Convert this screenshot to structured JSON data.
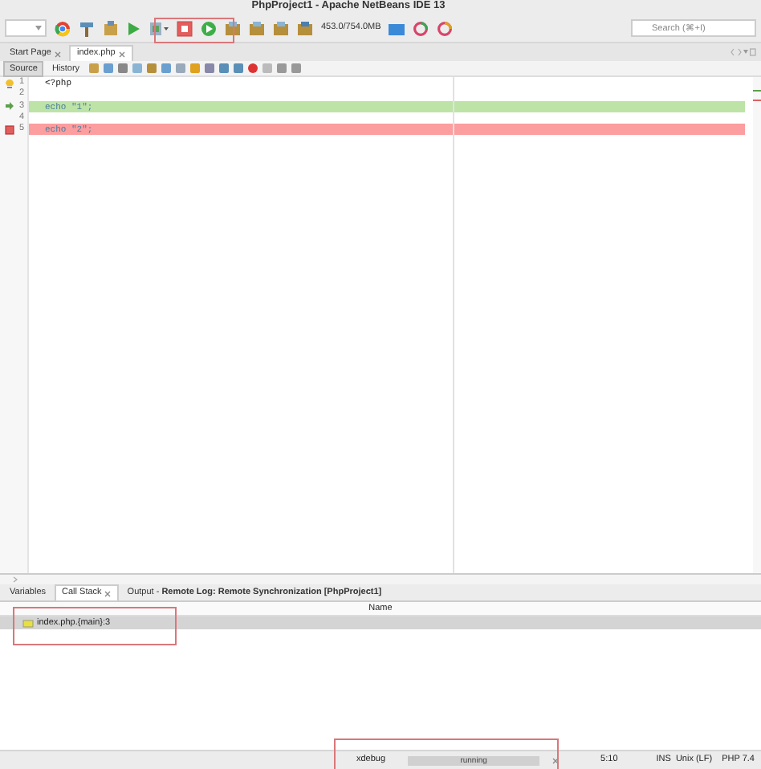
{
  "window": {
    "title": "PhpProject1 - Apache NetBeans IDE 13"
  },
  "toolbar": {
    "memory": "453.0/754.0MB",
    "search": {
      "placeholder": "Search (⌘+I)"
    }
  },
  "editor_tabs": [
    {
      "label": "Start Page",
      "selected": false,
      "closable": true
    },
    {
      "label": "index.php",
      "selected": true,
      "closable": true
    }
  ],
  "editor_views": [
    {
      "label": "Source",
      "selected": true
    },
    {
      "label": "History",
      "selected": false
    }
  ],
  "code_lines": [
    {
      "number": "1",
      "text": "<?php",
      "hint": true,
      "current": false,
      "breakpoint": false
    },
    {
      "number": "2",
      "hint": false,
      "current": false,
      "breakpoint": false
    },
    {
      "number": "3",
      "text": "echo \"1\";",
      "hint": false,
      "current": true,
      "breakpoint": false
    },
    {
      "number": "4",
      "hint": false,
      "current": false,
      "breakpoint": false
    },
    {
      "number": "5",
      "text": "echo \"2\";",
      "hint": false,
      "current": false,
      "breakpoint": true
    }
  ],
  "bottom_tabs": [
    {
      "label": "Variables",
      "selected": false,
      "closable": false
    },
    {
      "label": "Call Stack",
      "selected": true,
      "closable": true
    },
    {
      "label": "Output - **Remote Log: Remote Synchronization [PhpProject1]**",
      "selected": false,
      "closable": false
    }
  ],
  "call_stack": {
    "columns": [
      "Name"
    ],
    "rows": [
      {
        "name": "index.php.{main}:3",
        "selected": true
      }
    ]
  },
  "status_bar": {
    "task": "xdebug",
    "progress_text": "running",
    "level": 1,
    "position": "5:10",
    "mode": "INS",
    "line_endings": "Unix (LF)",
    "platform": "PHP 7.4"
  }
}
